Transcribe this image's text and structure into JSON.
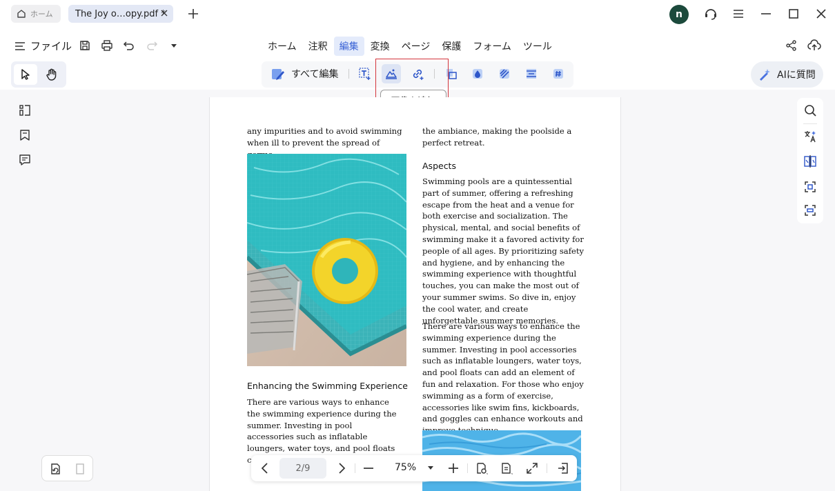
{
  "titlebar": {
    "home_tab": "ホーム",
    "doc_tab": "The Joy o…opy.pdf *",
    "avatar_letter": "n"
  },
  "menu": {
    "file": "ファイル",
    "tabs": [
      "ホーム",
      "注釈",
      "編集",
      "変換",
      "ページ",
      "保護",
      "フォーム",
      "ツール"
    ],
    "active_tab": "編集"
  },
  "toolbar": {
    "edit_all": "すべて編集",
    "tooltip": "画像を追加",
    "ai": "AIに質問"
  },
  "document": {
    "left_intro": "any impurities and to avoid swimming when ill to prevent the spread of germs.",
    "left_heading": "Enhancing the Swimming Experience",
    "left_body": "There are various ways to enhance the swimming experience during the summer. Investing in pool accessories such as inflatable loungers, water toys, and pool floats can add an element of fun and r",
    "right_intro": "the ambiance, making the poolside a perfect retreat.",
    "right_heading": "Aspects",
    "right_p1": "Swimming pools are a quintessential part of summer, offering a refreshing escape from the heat and a venue for both exercise and socialization. The physical, mental, and social benefits of swimming make it a favored activity for people of all ages. By prioritizing safety and hygiene, and by enhancing the swimming experience with thoughtful touches, you can make the most out of your summer swims. So dive in, enjoy the cool water, and create unforgettable summer memories.",
    "right_p2": "There are various ways to enhance the swimming experience during the summer. Investing in pool accessories such as inflatable loungers, water toys, and pool floats can add an element of fun and relaxation. For those who enjoy swimming as a form of exercise, accessories like swim fins, kickboards, and goggles can enhance workouts and improve technique."
  },
  "nav": {
    "page": "2/9",
    "zoom": "75%"
  },
  "colors": {
    "accent": "#3a63d6",
    "avatar": "#1c4a3c",
    "highlight_box": "#d3333a"
  }
}
